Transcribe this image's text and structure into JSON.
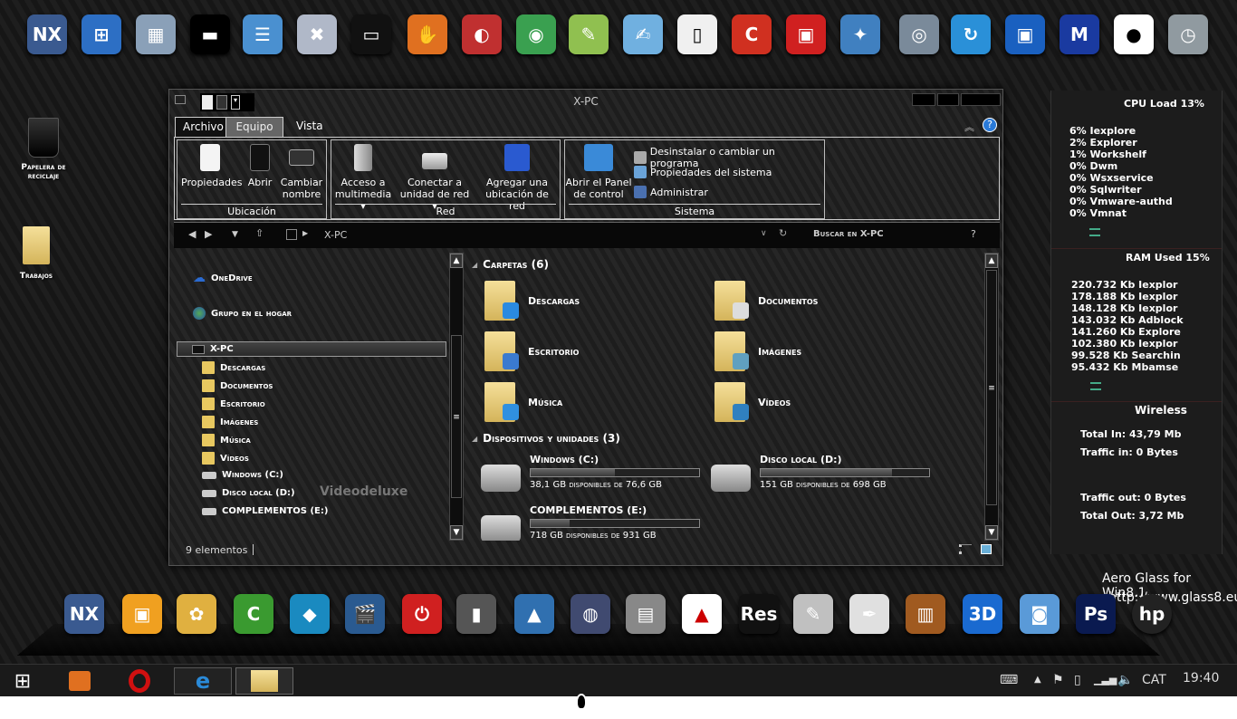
{
  "top_dock": [
    {
      "icon": "nexus-icon",
      "color": "#3a5a90",
      "glyph": "NX"
    },
    {
      "icon": "windows-logo-icon",
      "color": "#2d6fc4",
      "glyph": "⊞"
    },
    {
      "icon": "performance-monitor-icon",
      "color": "#8aa0b8",
      "glyph": "▦"
    },
    {
      "icon": "cmd-icon",
      "color": "#000000",
      "glyph": "▬"
    },
    {
      "icon": "control-panel-icon",
      "color": "#4a90d0",
      "glyph": "☰"
    },
    {
      "icon": "uninstall-icon",
      "color": "#b0b8c8",
      "glyph": "✖"
    },
    {
      "icon": "laptop-icon",
      "color": "#111111",
      "glyph": "▭"
    },
    {
      "icon": "paw-icon",
      "color": "#e07020",
      "glyph": "✋"
    },
    {
      "icon": "mouse-icon",
      "color": "#c03030",
      "glyph": "◐"
    },
    {
      "icon": "chrome-icon",
      "color": "#3aa050",
      "glyph": "◉"
    },
    {
      "icon": "notepad-plus-icon",
      "color": "#90c050",
      "glyph": "✎"
    },
    {
      "icon": "notepad-icon",
      "color": "#70b0e0",
      "glyph": "✍"
    },
    {
      "icon": "blank-document-icon",
      "color": "#f0f0f0",
      "glyph": "▯"
    },
    {
      "icon": "ccleaner-icon",
      "color": "#d03020",
      "glyph": "C"
    },
    {
      "icon": "red-box-icon",
      "color": "#d02020",
      "glyph": "▣"
    },
    {
      "icon": "wizard-icon",
      "color": "#4080c0",
      "glyph": "✦"
    },
    {
      "icon": "hard-disk-icon",
      "color": "#7a8a9a",
      "glyph": "◎"
    },
    {
      "icon": "sync-icon",
      "color": "#2a90d8",
      "glyph": "↻"
    },
    {
      "icon": "remote-desktop-icon",
      "color": "#1a60c0",
      "glyph": "▣"
    },
    {
      "icon": "malwarebytes-icon",
      "color": "#1a3aa0",
      "glyph": "M"
    },
    {
      "icon": "panda-icon",
      "color": "#ffffff",
      "glyph": "●"
    },
    {
      "icon": "clock-monitor-icon",
      "color": "#909aa0",
      "glyph": "◷"
    }
  ],
  "desktop": {
    "recycle_bin": "Papelera de reciclaje",
    "trabajos": "Trabajos"
  },
  "window": {
    "title": "X-PC",
    "tabs": [
      "Archivo",
      "Equipo",
      "Vista"
    ],
    "active_tab": "Equipo",
    "groups": {
      "ubicacion": {
        "label": "Ubicación",
        "buttons": [
          "Propiedades",
          "Abrir",
          "Cambiar nombre"
        ]
      },
      "red": {
        "label": "Red",
        "buttons": [
          "Acceso a multimedia",
          "Conectar a unidad de red",
          "Agregar una ubicación de red"
        ]
      },
      "sistema": {
        "label": "Sistema",
        "big": "Abrir el Panel de control",
        "small": [
          "Desinstalar o cambiar un programa",
          "Propiedades del sistema",
          "Administrar"
        ]
      }
    },
    "address": {
      "path": "X-PC",
      "search_placeholder": "Buscar en X-PC",
      "help": "?"
    },
    "nav": {
      "onedrive": "OneDrive",
      "homegroup": "Grupo en el hogar",
      "pc": "X-PC",
      "items": [
        "Descargas",
        "Documentos",
        "Escritorio",
        "Imágenes",
        "Música",
        "Vídeos",
        "Windows (C:)",
        "Disco local (D:)",
        "COMPLEMENTOS (E:)"
      ]
    },
    "watermark": "Videodeluxe",
    "folders_header": "Carpetas (6)",
    "folders": [
      {
        "name": "Descargas",
        "accent": "#2a8ae0"
      },
      {
        "name": "Documentos",
        "accent": "#dddddd"
      },
      {
        "name": "Escritorio",
        "accent": "#3a7ad0"
      },
      {
        "name": "Imágenes",
        "accent": "#60a0c0"
      },
      {
        "name": "Música",
        "accent": "#3090e0"
      },
      {
        "name": "Vídeos",
        "accent": "#3080c0"
      }
    ],
    "devices_header": "Dispositivos y unidades (3)",
    "drives": [
      {
        "name": "Windows (C:)",
        "info": "38,1 GB disponibles de 76,6 GB",
        "used_pct": 50
      },
      {
        "name": "Disco local (D:)",
        "info": "151 GB disponibles de 698 GB",
        "used_pct": 78
      },
      {
        "name": "COMPLEMENTOS (E:)",
        "info": "718 GB disponibles de 931 GB",
        "used_pct": 23
      }
    ],
    "status": "9 elementos"
  },
  "widget": {
    "cpu_title": "CPU Load 13%",
    "cpu": [
      "6% Iexplore",
      "2% Explorer",
      "1% Workshelf",
      "0% Dwm",
      "0% Wsxservice",
      "0% Sqlwriter",
      "0% Vmware-authd",
      "0% Vmnat"
    ],
    "ram_title": "RAM Used 15%",
    "ram": [
      "220.732 Kb Iexplor",
      "178.188 Kb Iexplor",
      "148.128 Kb Iexplor",
      "143.032 Kb Adblock",
      "141.260 Kb Explore",
      "102.380 Kb Iexplor",
      "99.528 Kb Searchin",
      "95.432 Kb Mbamse"
    ],
    "wireless_title": "Wireless",
    "total_in": "Total In: 43,79 Mb",
    "traffic_in": "Traffic in: 0 Bytes",
    "traffic_out": "Traffic out: 0 Bytes",
    "total_out": "Total Out: 3,72 Mb"
  },
  "aero": {
    "line1": "Aero Glass for Win8.1",
    "line2": "http://www.glass8.eu"
  },
  "bottom_dock": [
    {
      "icon": "nexus-icon",
      "color": "#3a5a90",
      "glyph": "NX"
    },
    {
      "icon": "vmware-icon",
      "color": "#f0a020",
      "glyph": "▣"
    },
    {
      "icon": "paint-icon",
      "color": "#e0b040",
      "glyph": "✿"
    },
    {
      "icon": "camtasia-icon",
      "color": "#3a9a30",
      "glyph": "C"
    },
    {
      "icon": "kodi-icon",
      "color": "#1a8ac0",
      "glyph": "◆"
    },
    {
      "icon": "video-editor-icon",
      "color": "#2a5a90",
      "glyph": "🎬"
    },
    {
      "icon": "power-icon",
      "color": "#d02020",
      "glyph": "⏻"
    },
    {
      "icon": "usb-drive-icon",
      "color": "#555555",
      "glyph": "▮"
    },
    {
      "icon": "aimp-icon",
      "color": "#3070b0",
      "glyph": "▲"
    },
    {
      "icon": "globe-icon",
      "color": "#404a70",
      "glyph": "◍"
    },
    {
      "icon": "device-manager-icon",
      "color": "#888888",
      "glyph": "▤"
    },
    {
      "icon": "color-window-icon",
      "color": "#ffffff",
      "glyph": "▲"
    },
    {
      "icon": "resource-hacker-icon",
      "color": "#111111",
      "glyph": "Res"
    },
    {
      "icon": "notes-icon",
      "color": "#c0c0c0",
      "glyph": "✎"
    },
    {
      "icon": "brush-icon",
      "color": "#e0e0e0",
      "glyph": "✒"
    },
    {
      "icon": "winrar-icon",
      "color": "#a05a20",
      "glyph": "▥"
    },
    {
      "icon": "3d-icon",
      "color": "#1a6ad0",
      "glyph": "3D"
    },
    {
      "icon": "camera-icon",
      "color": "#5a9ad8",
      "glyph": "◙"
    },
    {
      "icon": "photoshop-icon",
      "color": "#0a1a50",
      "glyph": "Ps"
    },
    {
      "icon": "hp-icon",
      "color": "#222222",
      "glyph": "hp"
    }
  ],
  "taskbar": {
    "apps": [
      {
        "icon": "start-windows-icon"
      },
      {
        "icon": "media-player-icon"
      },
      {
        "icon": "opera-icon"
      },
      {
        "icon": "internet-explorer-icon"
      },
      {
        "icon": "file-explorer-icon"
      }
    ],
    "language": "CAT",
    "time": "19:40"
  }
}
